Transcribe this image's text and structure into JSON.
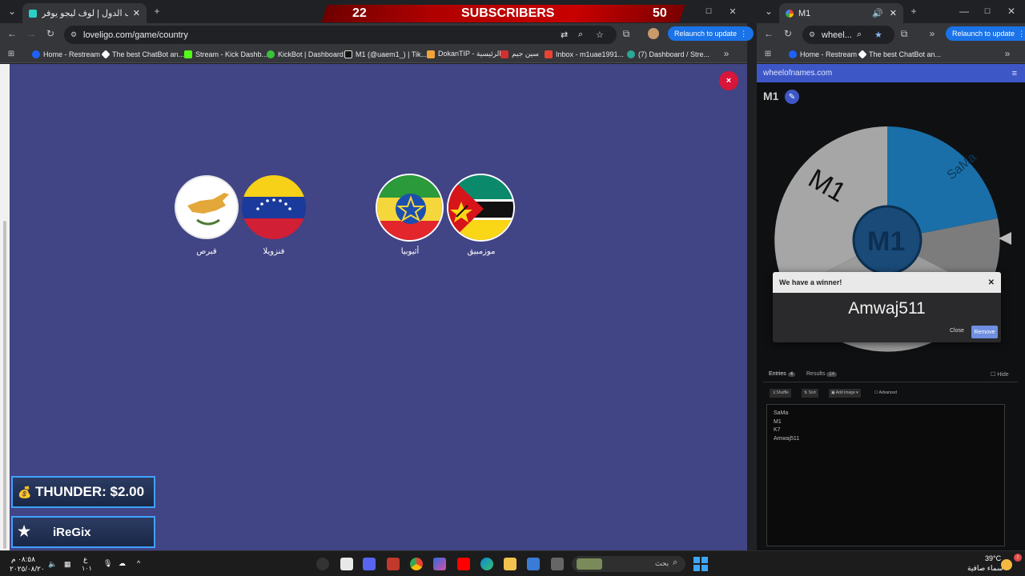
{
  "left_browser": {
    "tab_title": "لعبة حرب الدول | لوف ليجو يوفر",
    "url": "loveligo.com/game/country",
    "relaunch_label": "Relaunch to update",
    "bookmarks": [
      {
        "label": "Home - Restream",
        "color": "#1c62ff"
      },
      {
        "label": "The best ChatBot an...",
        "color": "#ffffff"
      },
      {
        "label": "Stream - Kick Dashb...",
        "color": "#53fc18"
      },
      {
        "label": "KickBot | Dashboard",
        "color": "#39c33a"
      },
      {
        "label": "M1 (@uaem1_) | Tik...",
        "color": "#111111"
      },
      {
        "label": "DokanTIP - الرئيسية",
        "color": "#f2a33a"
      },
      {
        "label": "سين جيم",
        "color": "#d03030"
      },
      {
        "label": "Inbox - m1uae1991...",
        "color": "#ea4335"
      },
      {
        "label": "(7) Dashboard / Stre...",
        "color": "#2aa896"
      }
    ]
  },
  "overlay": {
    "subscriber_current": "22",
    "subscriber_label": "SUBSCRIBERS",
    "subscriber_goal": "50",
    "donation_text": "THUNDER: $2.00",
    "follower_name": "iReGix"
  },
  "game": {
    "countries": [
      {
        "name": "قبرص",
        "flag": "cyprus"
      },
      {
        "name": "فنزويلا",
        "flag": "venezuela"
      },
      {
        "name": "أثيوبيا",
        "flag": "ethiopia"
      },
      {
        "name": "موزمبيق",
        "flag": "mozambique"
      }
    ],
    "close_symbol": "×"
  },
  "right_browser": {
    "tab_title": "M1",
    "url": "wheel...",
    "relaunch_label": "Relaunch to update",
    "bookmarks": [
      {
        "label": "Home - Restream"
      },
      {
        "label": "The best ChatBot an..."
      }
    ],
    "site_name": "wheelofnames.com",
    "wheel_title": "M1",
    "wheel_segments": [
      "SaMa",
      "M1",
      "K7",
      "Amwaj511"
    ],
    "winner_dialog": {
      "heading": "We have a winner!",
      "winner": "Amwaj511",
      "close_label": "Close",
      "remove_label": "Remove"
    },
    "tabs": {
      "entries_label": "Entries",
      "entries_count": "4",
      "results_label": "Results",
      "results_count": "14",
      "hide_label": "Hide"
    },
    "actions": {
      "shuffle": "Shuffle",
      "sort": "Sort",
      "add_image": "Add image",
      "advanced": "Advanced"
    },
    "entries": [
      "SaMa",
      "M1",
      "K7",
      "Amwaj511"
    ]
  },
  "taskbar": {
    "time": "٠٨:٥٨ م",
    "date": "٢٠٢٥/٠٨/٢٠",
    "lang": "ع",
    "lang_sub": "١٠١",
    "search_placeholder": "بحث",
    "temperature": "39°C",
    "weather": "سماء صافية"
  }
}
